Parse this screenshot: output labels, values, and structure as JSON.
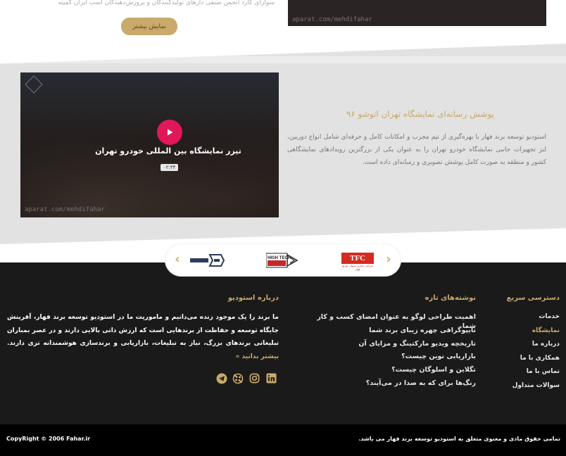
{
  "top": {
    "partial_text": "سوارای کارد انجمن صنفی دارهای تولیدکنندگان و پرورش‌دهندگان اسب ایران کمیته",
    "show_more_label": "نمایش بیشتر",
    "video_watermark": "aparat.com/mehdifahar"
  },
  "project": {
    "title": "پوشش رسانه‌ای نمایشگاه تهران اتوشو ۹۶",
    "description": "استودیو توسعه برند فهار با بهره‌گیری از تیم مجرب و امکانات کامل و حرفه‌ای شامل انواع دوربین، لنز تجهیزات جانبی نمایشگاه خودرو تهران را به عنوان یکی از بزرگترین رویدادهای نمایشگاهی کشور و منطقه به صورت کامل پوشش تصویری و رسانه‌ای داده است.",
    "video": {
      "title": "تیزر نمایشگاه بین المللی خودرو تهران",
      "duration": "۰۲:۳۴",
      "watermark": "aparat.com/mehdifahar"
    }
  },
  "partners": {
    "logos": [
      {
        "name": "TFC",
        "text": "TFC",
        "subtext": "شرکت تجاری سیپان توزیع فهار"
      },
      {
        "name": "High Tech",
        "text": "HIGH TECH"
      },
      {
        "name": "Third partner",
        "text": ""
      }
    ]
  },
  "footer": {
    "quick_access": {
      "title": "دسترسی سریع",
      "items": [
        "خدمات",
        "نمایشگاه",
        "درباره ما",
        "همکاری با ما",
        "تماس با ما",
        "سوالات متداول"
      ],
      "active_index": 1
    },
    "recent_posts": {
      "title": "نوشته‌های تازه",
      "items": [
        "اهمیت طراحی لوگو به عنوان امضای کسب و کار شما",
        "تایپوگرافی چهره زیبای برند شما",
        "تاریخچه ویدیو مارکتینگ و مزایای آن",
        "بازاریابی نوین چیست؟",
        "تگلاین و اسلوگان چیست؟",
        "رنگ‌ها برای که به صدا در می‌آیند؟"
      ]
    },
    "about": {
      "title": "درباره استودیو",
      "text": "ما برند را یک موجود زنده می‌دانیم و ماموریت ما در استودیو توسعه برند فهار، آفرینش جایگاه توسعه و حفاظت از برندهایی است که ارزش ذاتی بالایی دارند و در عصر بمباران تبلیغاتی برندهای بزرگ، نیاز به تبلیغات، بازاریابی و برندسازی هوشمندانه تری دارند.",
      "more_label": "بیشتر بدانید »"
    },
    "social_icons": [
      "linkedin-icon",
      "instagram-icon",
      "aparat-icon",
      "telegram-icon"
    ]
  },
  "bottom": {
    "copyright": "CopyRight © 2006 Fahar.ir",
    "rights": "تمامی حقوق مادی و معنوی متعلق به استودیو توسعه برند فهار می باشد."
  },
  "colors": {
    "accent": "#c9aa6a",
    "footer_bg": "#1a1a1a",
    "bottom_bg": "#000000",
    "play": "#e0185a",
    "section_bg": "#e2e2e2"
  }
}
